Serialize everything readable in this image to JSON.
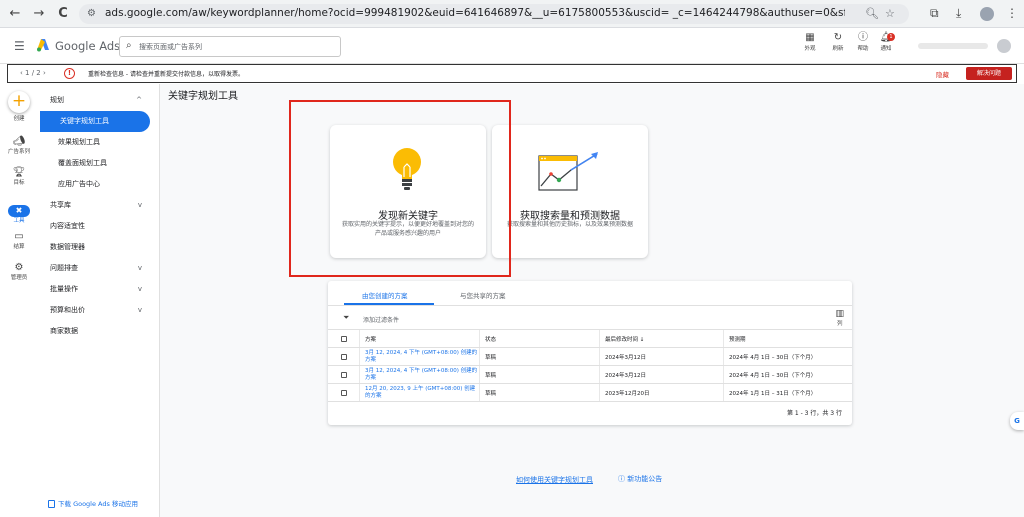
{
  "browser": {
    "url": "ads.google.com/aw/keywordplanner/home?ocid=999481902&euid=641646897&__u=6175800553&uscid=          _c=1464244798&authuser=0&sf=kp&subid=...",
    "back_icon": "←",
    "forward_icon": "→",
    "reload_icon": "C"
  },
  "header": {
    "product": "Google Ads",
    "search_placeholder": "搜索页面或广告系列",
    "tools": [
      {
        "label": "外观"
      },
      {
        "label": "刷新"
      },
      {
        "label": "帮助"
      },
      {
        "label": "通知"
      }
    ],
    "notification_count": "1"
  },
  "alert": {
    "pager": "1 / 2",
    "message": "重新检查信息 - 请检查并重新提交付款信息，以取得发票。",
    "hide_label": "隐藏",
    "fix_label": "解决问题"
  },
  "rail": {
    "create": "创建",
    "campaigns": "广告系列",
    "goals": "目标",
    "tools": "工具",
    "billing": "结算",
    "admin": "管理员"
  },
  "sidenav": {
    "items": [
      {
        "label": "规划",
        "chev": "^"
      },
      {
        "label": "关键字规划工具"
      },
      {
        "label": "效果规划工具"
      },
      {
        "label": "覆盖面规划工具"
      },
      {
        "label": "应用广告中心"
      },
      {
        "label": "共享库",
        "chev": "v"
      },
      {
        "label": "内容适宜性"
      },
      {
        "label": "数据管理器"
      },
      {
        "label": "问题排查",
        "chev": "v"
      },
      {
        "label": "批量操作",
        "chev": "v"
      },
      {
        "label": "预算和出价",
        "chev": "v"
      },
      {
        "label": "商家数据"
      }
    ],
    "mobile_link": "下载 Google Ads 移动应用"
  },
  "main": {
    "title": "关键字规划工具",
    "cards": [
      {
        "title": "发现新关键字",
        "desc": "获取实用的关键字提示，以便更好地覆盖到对您的产品或服务感兴趣的用户"
      },
      {
        "title": "获取搜索量和预测数据",
        "desc": "获取搜索量和其他历史指标，以及效果预测数据"
      }
    ]
  },
  "plans": {
    "tabs": [
      "由您创建的方案",
      "与您共享的方案"
    ],
    "filter": "添加过滤条件",
    "columns_label": "列",
    "headers": [
      "方案",
      "状态",
      "最后修改时间 ↓",
      "预测期"
    ],
    "rows": [
      {
        "name": "3月 12, 2024, 4 下午 (GMT+08:00) 创建的方案",
        "status": "草稿",
        "modified": "2024年3月12日",
        "period": "2024年 4月 1日 – 30日（下个月）"
      },
      {
        "name": "3月 12, 2024, 4 下午 (GMT+08:00) 创建的方案",
        "status": "草稿",
        "modified": "2024年3月12日",
        "period": "2024年 4月 1日 – 30日（下个月）"
      },
      {
        "name": "12月 20, 2023, 9 上午 (GMT+08:00) 创建的方案",
        "status": "草稿",
        "modified": "2023年12月20日",
        "period": "2024年 1月 1日 – 31日（下个月）"
      }
    ],
    "footer": "第 1 - 3 行，共 3 行"
  },
  "footer_links": {
    "howto": "如何使用关键字规划工具",
    "whatsnew": "新功能公告"
  }
}
